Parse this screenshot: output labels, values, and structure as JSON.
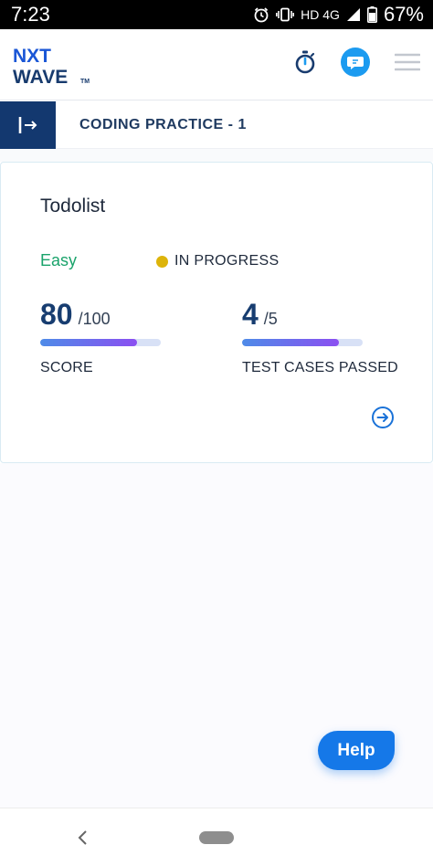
{
  "status_bar": {
    "time": "7:23",
    "network": "HD 4G",
    "battery": "67%"
  },
  "header": {
    "logo_line1": "NXT",
    "logo_line2": "WAVE",
    "logo_tm": "TM",
    "icons": [
      "stopwatch-icon",
      "chat-bubble-icon",
      "hamburger-menu-icon"
    ],
    "accent_color": "#1c9bf0"
  },
  "course": {
    "title": "CODING PRACTICE - 1"
  },
  "card": {
    "title": "Todolist",
    "difficulty": "Easy",
    "status": "IN PROGRESS",
    "status_color": "#ddb40a",
    "score": {
      "value": "80",
      "total": "/100",
      "label": "SCORE",
      "progress": 0.8
    },
    "tests": {
      "value": "4",
      "total": "/5",
      "label": "TEST CASES PASSED",
      "progress": 0.8
    }
  },
  "help": {
    "label": "Help"
  }
}
